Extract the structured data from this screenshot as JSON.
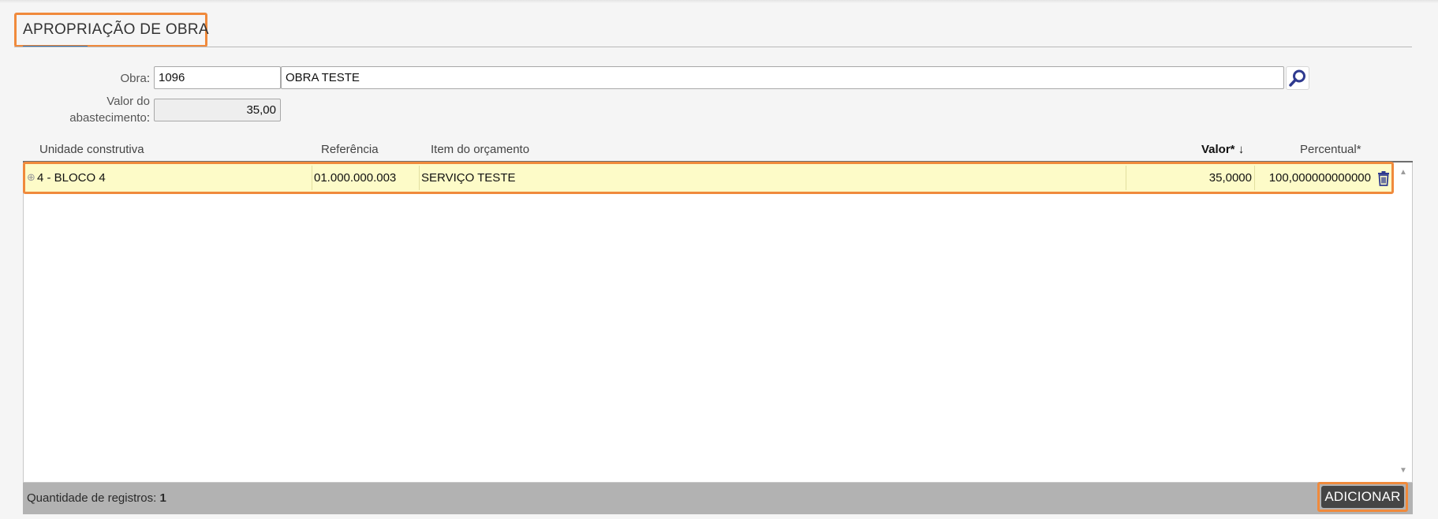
{
  "section": {
    "title": "APROPRIAÇÃO DE OBRA"
  },
  "form": {
    "obra_label": "Obra",
    "obra_code": "1096",
    "obra_name": "OBRA TESTE",
    "valor_label_line1": "Valor do",
    "valor_label_line2": "abastecimento",
    "valor_value": "35,00",
    "search_icon": "magnifier-icon"
  },
  "grid": {
    "columns": [
      "Unidade construtiva",
      "Referência",
      "Item do orçamento",
      "Valor*",
      "Percentual*"
    ],
    "sort_indicator": "↓",
    "rows": [
      {
        "unidade": "4 - BLOCO 4",
        "referencia": "01.000.000.003",
        "item": "SERVIÇO TESTE",
        "valor": "35,0000",
        "percentual": "100,000000000000"
      }
    ]
  },
  "footer": {
    "count_label": "Quantidade de registros:",
    "count_value": "1",
    "add_label": "ADICIONAR"
  },
  "colors": {
    "highlight": "#f08a3c",
    "row_bg": "#fdfbc8",
    "footer_bg": "#b2b2b2",
    "button_bg": "#454545",
    "icon_blue": "#2f3a8f"
  }
}
